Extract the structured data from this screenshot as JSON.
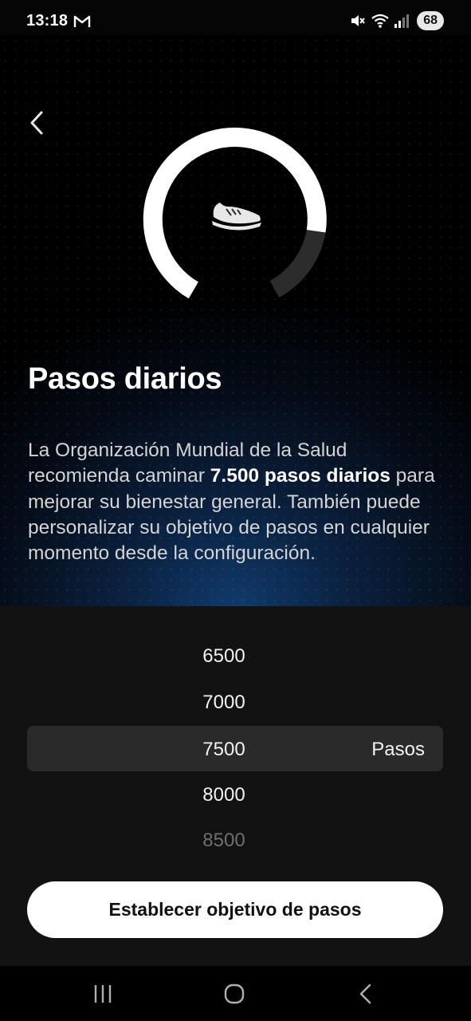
{
  "status_bar": {
    "time": "13:18",
    "battery": "68",
    "icons": [
      "gmail-icon",
      "mute-icon",
      "wifi-icon",
      "signal-icon",
      "battery-icon"
    ]
  },
  "hero": {
    "back_icon": "chevron-left-icon",
    "goal_icon": "shoe-icon",
    "title": "Pasos diarios",
    "description": {
      "before": "La Organización Mundial de la Salud recomienda caminar ",
      "highlight": "7.500 pasos diarios",
      "after": " para mejorar su bienestar general. También puede personalizar su objetivo de pasos en cualquier momento desde la configuración."
    }
  },
  "picker": {
    "options": [
      "6500",
      "7000",
      "7500",
      "8000",
      "8500"
    ],
    "selected_value": "7500",
    "unit": "Pasos"
  },
  "cta": {
    "label": "Establecer objetivo de pasos"
  },
  "nav_bar": {
    "icons": [
      "recent-apps-icon",
      "home-icon",
      "back-nav-icon"
    ]
  },
  "colors": {
    "background": "#000000",
    "panel": "#121212",
    "highlight_row": "#2a2a2a",
    "button": "#ffffff",
    "glow": "#103a6b"
  }
}
